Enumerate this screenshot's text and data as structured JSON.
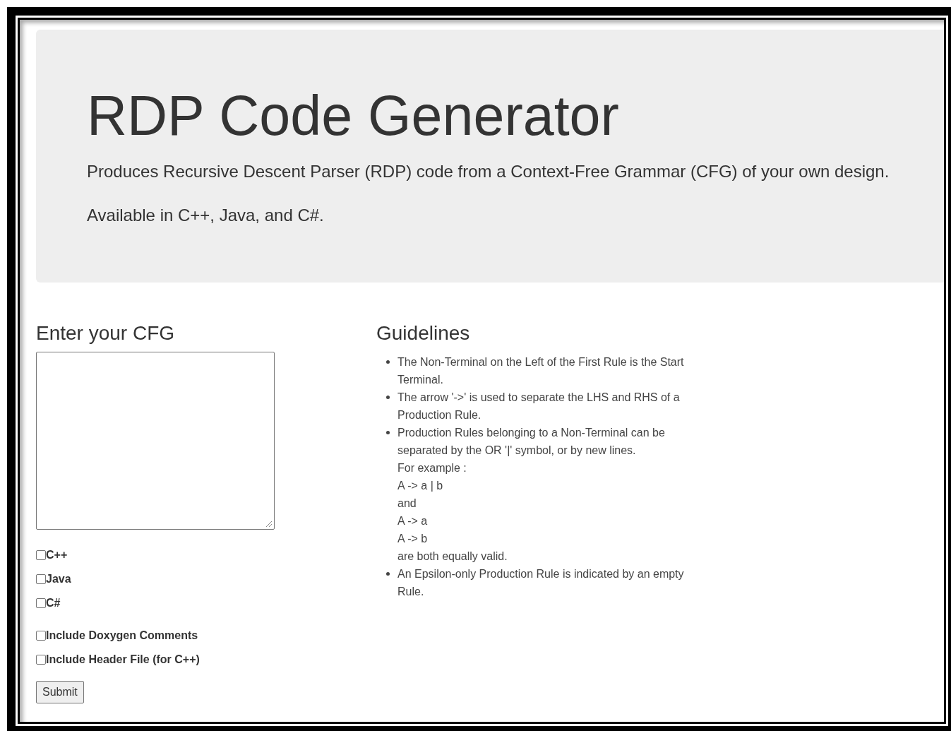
{
  "header": {
    "title": "RDP Code Generator",
    "lines": [
      "Produces Recursive Descent Parser (RDP) code from a Context-Free Grammar (CFG) of your own design.",
      "Available in C++, Java, and C#."
    ]
  },
  "form": {
    "heading": "Enter your CFG",
    "languages": [
      {
        "label": "C++",
        "checked": false
      },
      {
        "label": "Java",
        "checked": false
      },
      {
        "label": "C#",
        "checked": false
      }
    ],
    "options": [
      {
        "label": "Include Doxygen Comments",
        "checked": false
      },
      {
        "label": "Include Header File (for C++)",
        "checked": false
      }
    ],
    "submit": "Submit"
  },
  "guidelines": {
    "heading": "Guidelines",
    "items": [
      {
        "text": "The Non-Terminal on the Left of the First Rule is the Start Terminal."
      },
      {
        "text": "The arrow '->' is used to separate the LHS and RHS of a Production Rule."
      },
      {
        "text": "Production Rules belonging to a Non-Terminal can be separated by the OR '|' symbol, or by new lines.",
        "lines": [
          "For example :",
          "A -> a | b",
          "and",
          "A -> a",
          "A -> b",
          "are both equally valid."
        ]
      },
      {
        "text": "An Epsilon-only Production Rule is indicated by an empty Rule."
      }
    ]
  }
}
